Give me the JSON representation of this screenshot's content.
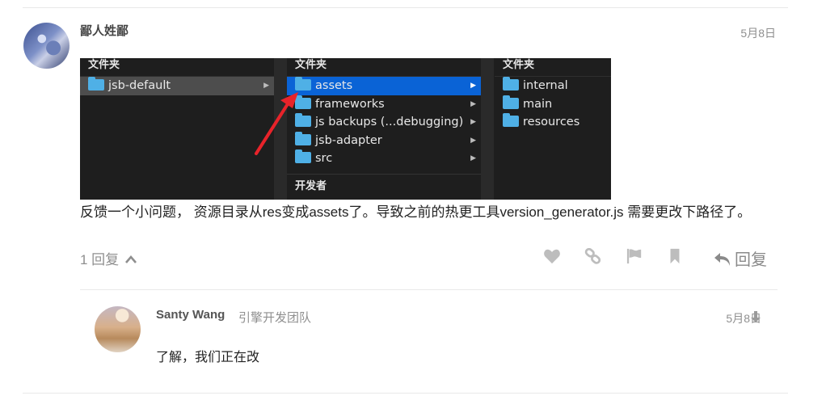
{
  "post": {
    "username": "鄙人姓鄙",
    "date": "5月8日",
    "text": "反馈一个小问题， 资源目录从res变成assets了。导致之前的热更工具version_generator.js 需要更改下路径了。",
    "replies_label": "1 回复",
    "reply_button": "回复"
  },
  "finder": {
    "columns": [
      {
        "header": "文件夹",
        "items": [
          {
            "name": "jsb-default"
          }
        ]
      },
      {
        "header": "文件夹",
        "items": [
          {
            "name": "assets"
          },
          {
            "name": "frameworks"
          },
          {
            "name": "js backups (...debugging)"
          },
          {
            "name": "jsb-adapter"
          },
          {
            "name": "src"
          }
        ],
        "footer": "开发者"
      },
      {
        "header": "文件夹",
        "items": [
          {
            "name": "internal"
          },
          {
            "name": "main"
          },
          {
            "name": "resources"
          }
        ]
      }
    ]
  },
  "reply": {
    "username": "Santy Wang",
    "team": "引擎开发团队",
    "date": "5月8日",
    "text": "了解，我们正在改"
  },
  "colors": {
    "selection_blue": "#0a63d6",
    "folder_blue": "#4fb0e6",
    "annotation_arrow": "#e8232a",
    "muted_text": "#8f8f8f"
  },
  "icons": [
    "heart-icon",
    "link-icon",
    "flag-icon",
    "bookmark-icon",
    "reply-icon",
    "chevron-up-icon",
    "arrow-down-icon"
  ]
}
